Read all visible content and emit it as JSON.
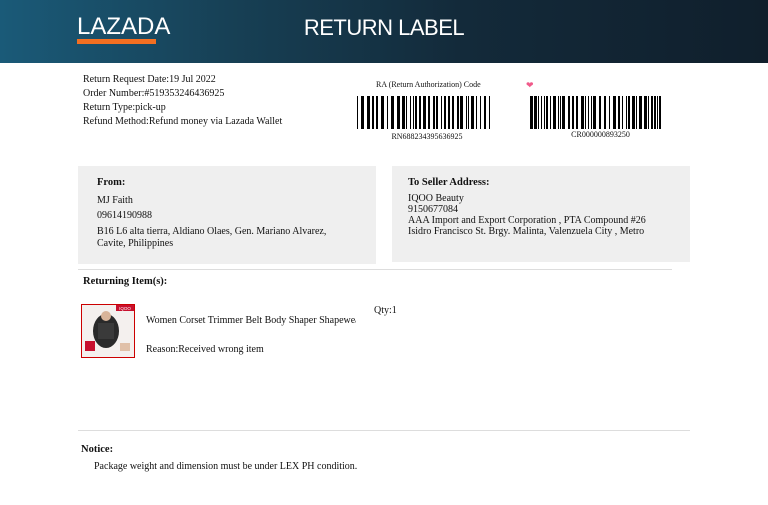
{
  "header": {
    "brand": "LAZADA",
    "title": "RETURN LABEL",
    "brand_color": "#f36f21"
  },
  "meta": {
    "request_date": "Return Request Date:19 Jul 2022",
    "order_number": "Order Number:#519353246436925",
    "return_type": "Return Type:pick-up",
    "refund_method": "Refund Method:Refund money via Lazada Wallet"
  },
  "ra": {
    "label": "RA (Return Authorization) Code",
    "barcode1": "RN688234395636925",
    "barcode2": "CR000000893250"
  },
  "from": {
    "heading": "From:",
    "name": "MJ Faith",
    "phone": "09614190988",
    "address": "B16 L6 alta tierra, Aldiano Olaes, Gen. Mariano Alvarez, Cavite, Philippines"
  },
  "to": {
    "heading": "To Seller Address:",
    "name": "IQOO Beauty",
    "phone": "9150677084",
    "address": "AAA Import and Export Corporation , PTA Compound #26 Isidro Francisco St. Brgy. Malinta, Valenzuela City , Metro"
  },
  "items": {
    "heading": "Returning Item(s):",
    "name": "Women Corset Trimmer Belt Body Shaper Shapewear",
    "qty": "Qty:1",
    "reason": "Reason:Received wrong item",
    "thumb_badge": "IQOO"
  },
  "notice": {
    "heading": "Notice:",
    "text": "Package weight and dimension must be under LEX PH condition."
  }
}
